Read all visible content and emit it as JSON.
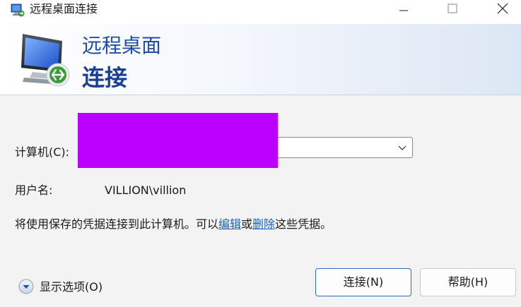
{
  "window": {
    "title": "远程桌面连接",
    "controls": {
      "minimize": "minimize",
      "maximize": "maximize",
      "close": "close"
    }
  },
  "banner": {
    "line1": "远程桌面",
    "line2": "连接"
  },
  "form": {
    "computer_label": "计算机(C):",
    "computer_value": "",
    "user_label": "用户名:",
    "user_value": "VILLION\\villion",
    "saved_text_before": "将使用保存的凭据连接到此计算机。可以",
    "edit_link": "编辑",
    "saved_text_or": "或",
    "delete_link": "删除",
    "saved_text_after": "这些凭据。"
  },
  "footer": {
    "options_label": "显示选项(O)",
    "connect_label": "连接(N)",
    "help_label": "帮助(H)"
  },
  "colors": {
    "accent": "#1f4da8",
    "link": "#1565c0",
    "redaction": "#bb00ff"
  }
}
